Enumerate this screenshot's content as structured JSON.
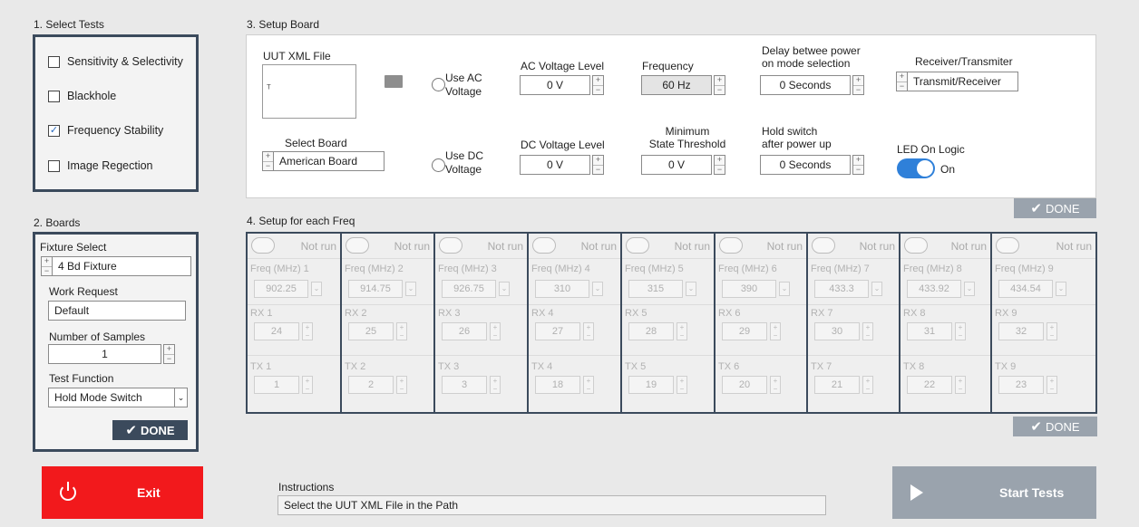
{
  "select_tests": {
    "title": "1. Select Tests",
    "items": [
      {
        "label": "Sensitivity & Selectivity",
        "checked": false
      },
      {
        "label": "Blackhole",
        "checked": false
      },
      {
        "label": "Frequency Stability",
        "checked": true
      },
      {
        "label": "Image Regection",
        "checked": false
      }
    ]
  },
  "boards": {
    "title": "2. Boards",
    "fixture_label": "Fixture Select",
    "fixture_value": "4 Bd Fixture",
    "work_request_label": "Work Request",
    "work_request_value": "Default",
    "samples_label": "Number of Samples",
    "samples_value": "1",
    "test_function_label": "Test Function",
    "test_function_value": "Hold Mode Switch",
    "done_label": "DONE"
  },
  "setup_board": {
    "title": "3. Setup Board",
    "uut_xml_label": "UUT XML File",
    "use_ac_label": "Use AC\nVoltage",
    "use_dc_label": "Use DC\nVoltage",
    "select_board_label": "Select Board",
    "select_board_value": "American Board",
    "ac_voltage_label": "AC Voltage Level",
    "ac_voltage_value": "0 V",
    "dc_voltage_label": "DC Voltage Level",
    "dc_voltage_value": "0 V",
    "frequency_label": "Frequency",
    "frequency_value": "60 Hz",
    "min_state_label": "Minimum\nState Threshold",
    "min_state_value": "0 V",
    "delay_label": "Delay betwee power\non mode selection",
    "delay_value": "0 Seconds",
    "hold_label": "Hold switch\nafter power up",
    "hold_value": "0 Seconds",
    "rx_tx_label": "Receiver/Transmiter",
    "rx_tx_value": "Transmit/Receiver",
    "led_label": "LED On Logic",
    "led_state": "On",
    "done_label": "DONE"
  },
  "setup_freq": {
    "title": "4. Setup for each Freq",
    "not_run_label": "Not run",
    "columns": [
      {
        "freq_label": "Freq (MHz) 1",
        "freq": "902.25",
        "rx_label": "RX 1",
        "rx": "24",
        "tx_label": "TX 1",
        "tx": "1"
      },
      {
        "freq_label": "Freq (MHz) 2",
        "freq": "914.75",
        "rx_label": "RX 2",
        "rx": "25",
        "tx_label": "TX 2",
        "tx": "2"
      },
      {
        "freq_label": "Freq (MHz) 3",
        "freq": "926.75",
        "rx_label": "RX 3",
        "rx": "26",
        "tx_label": "TX 3",
        "tx": "3"
      },
      {
        "freq_label": "Freq (MHz) 4",
        "freq": "310",
        "rx_label": "RX 4",
        "rx": "27",
        "tx_label": "TX 4",
        "tx": "18"
      },
      {
        "freq_label": "Freq (MHz) 5",
        "freq": "315",
        "rx_label": "RX 5",
        "rx": "28",
        "tx_label": "TX 5",
        "tx": "19"
      },
      {
        "freq_label": "Freq (MHz) 6",
        "freq": "390",
        "rx_label": "RX 6",
        "rx": "29",
        "tx_label": "TX 6",
        "tx": "20"
      },
      {
        "freq_label": "Freq (MHz) 7",
        "freq": "433.3",
        "rx_label": "RX 7",
        "rx": "30",
        "tx_label": "TX 7",
        "tx": "21"
      },
      {
        "freq_label": "Freq (MHz) 8",
        "freq": "433.92",
        "rx_label": "RX 8",
        "rx": "31",
        "tx_label": "TX 8",
        "tx": "22"
      },
      {
        "freq_label": "Freq (MHz) 9",
        "freq": "434.54",
        "rx_label": "RX 9",
        "rx": "32",
        "tx_label": "TX 9",
        "tx": "23"
      }
    ],
    "done_label": "DONE"
  },
  "footer": {
    "exit_label": "Exit",
    "instructions_label": "Instructions",
    "instructions_value": "Select the UUT XML File in the Path",
    "start_label": "Start Tests"
  },
  "colors": {
    "panel_border": "#3b4a5c",
    "exit_red": "#f2191c",
    "toggle_blue": "#2f80d9",
    "disabled_gray": "#9aa3ad"
  }
}
